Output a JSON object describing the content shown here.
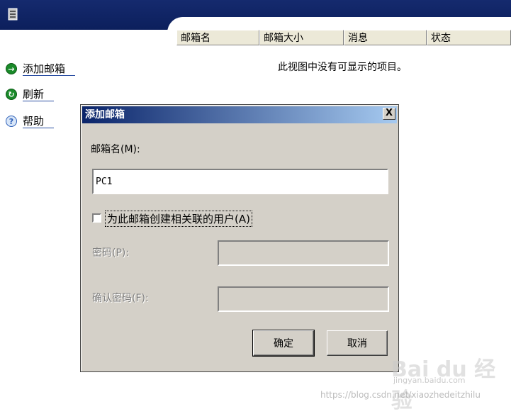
{
  "list": {
    "columns": [
      "邮箱名",
      "邮箱大小",
      "消息",
      "状态"
    ],
    "empty_message": "此视图中没有可显示的项目。"
  },
  "actions": [
    {
      "label": "添加邮箱",
      "icon": "add-arrow-icon",
      "color": "#1a8a2a"
    },
    {
      "label": "刷新",
      "icon": "refresh-icon",
      "color": "#1a8a2a"
    },
    {
      "label": "帮助",
      "icon": "help-icon",
      "color": "#2d5fb8"
    }
  ],
  "dialog": {
    "title": "添加邮箱",
    "close_label": "X",
    "mailbox_name_label": "邮箱名(M):",
    "mailbox_name_value": "PC1",
    "create_user_label": "为此邮箱创建相关联的用户(A)",
    "create_user_checked": false,
    "password_label": "密码(P):",
    "confirm_password_label": "确认密码(F):",
    "ok_label": "确定",
    "cancel_label": "取消"
  },
  "watermark": {
    "logo": "Bai du 经验",
    "sub": "jingyan.baidu.com",
    "url": "https://blog.csdn.net/xiaozhedeitzhilu"
  },
  "colors": {
    "banner": "#0c1f5c",
    "dialog_bg": "#d4d0c8",
    "title_gradient_start": "#0a246a"
  }
}
